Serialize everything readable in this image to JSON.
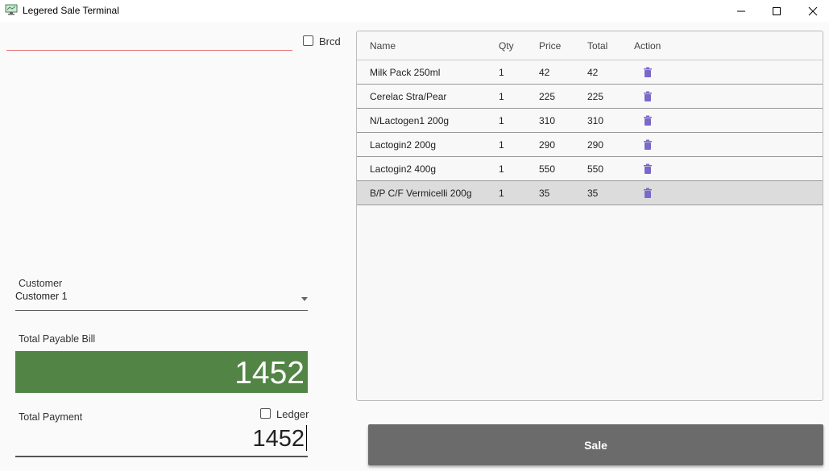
{
  "window": {
    "title": "Legered Sale Terminal"
  },
  "barcode": {
    "checkbox_label": "Brcd",
    "checked": false,
    "value": ""
  },
  "customer": {
    "label": "Customer",
    "selected": "Customer 1"
  },
  "bill": {
    "label": "Total Payable Bill",
    "value": "1452"
  },
  "payment": {
    "label": "Total Payment",
    "value": "1452",
    "ledger_label": "Ledger",
    "ledger_checked": false
  },
  "table": {
    "columns": [
      "Name",
      "Qty",
      "Price",
      "Total",
      "Action"
    ],
    "rows": [
      {
        "name": "Milk Pack 250ml",
        "qty": "1",
        "price": "42",
        "total": "42"
      },
      {
        "name": "Cerelac Stra/Pear",
        "qty": "1",
        "price": "225",
        "total": "225"
      },
      {
        "name": "N/Lactogen1 200g",
        "qty": "1",
        "price": "310",
        "total": "310"
      },
      {
        "name": "Lactogin2 200g",
        "qty": "1",
        "price": "290",
        "total": "290"
      },
      {
        "name": "Lactogin2 400g",
        "qty": "1",
        "price": "550",
        "total": "550"
      },
      {
        "name": "B/P C/F Vermicelli 200g",
        "qty": "1",
        "price": "35",
        "total": "35"
      }
    ],
    "selected_row": 5,
    "action_icon": "delete-icon"
  },
  "sale_button": {
    "label": "Sale"
  },
  "colors": {
    "bill_bg": "#528545",
    "sale_bg": "#6b6b6b",
    "barcode_underline": "#e57373",
    "delete_icon": "#7b68c8",
    "selected_row": "#dcdcdc"
  }
}
